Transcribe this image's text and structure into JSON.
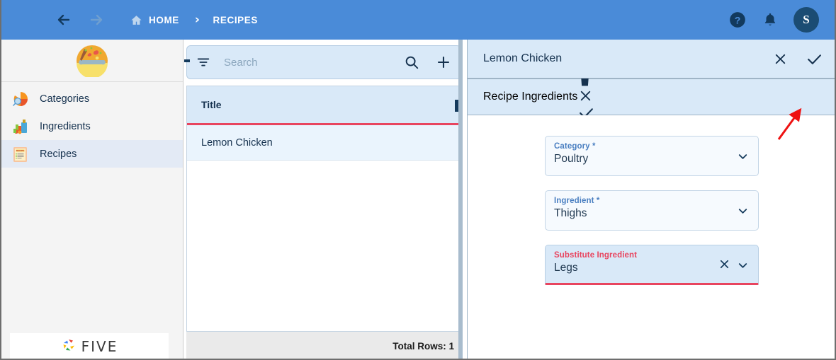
{
  "appbar": {
    "menu_icon": "hamburger-menu-icon",
    "back_icon": "arrow-left-icon",
    "forward_icon": "arrow-right-icon",
    "home_icon": "home-icon",
    "home_label": "HOME",
    "separator": "›",
    "current_label": "RECIPES",
    "help_icon": "help-circle-icon",
    "notifications_icon": "bell-icon",
    "avatar_initial": "S",
    "background_color": "#4a8bd8"
  },
  "sidebar": {
    "logo_icon": "salad-bowl-emoji",
    "logo_glyph": "🥗",
    "items": [
      {
        "label": "Categories",
        "icon": "categories-icon",
        "active": false
      },
      {
        "label": "Ingredients",
        "icon": "ingredients-icon",
        "active": false
      },
      {
        "label": "Recipes",
        "icon": "recipes-icon",
        "active": true
      }
    ],
    "footer": {
      "brand_icon": "five-logo-icon",
      "brand_label": "FIVE"
    },
    "active_background": "#e3eaf5"
  },
  "list_panel": {
    "search": {
      "filter_icon": "filter-icon",
      "placeholder": "Search",
      "value": "",
      "search_icon": "search-icon",
      "add_icon": "plus-icon"
    },
    "grid": {
      "columns": [
        "Title"
      ],
      "rows": [
        {
          "title": "Lemon Chicken"
        }
      ],
      "header_accent_color": "#e8455f",
      "selected_row_color": "#eaf4fd"
    },
    "footer": {
      "total_rows_label": "Total Rows: 1"
    }
  },
  "detail_panel": {
    "record_bar": {
      "title": "Lemon Chicken",
      "cancel_icon": "close-x-icon",
      "confirm_icon": "check-icon"
    },
    "section_bar": {
      "title": "Recipe Ingredients",
      "delete_icon": "trash-icon",
      "cancel_icon": "close-x-icon",
      "confirm_icon": "check-icon"
    },
    "fields": [
      {
        "label": "Category *",
        "value": "Poultry",
        "dropdown_icon": "chevron-down-icon",
        "focused": false,
        "clearable": false
      },
      {
        "label": "Ingredient *",
        "value": "Thighs",
        "dropdown_icon": "chevron-down-icon",
        "focused": false,
        "clearable": false
      },
      {
        "label": "Substitute Ingredient",
        "value": "Legs",
        "dropdown_icon": "chevron-down-icon",
        "clear_icon": "clear-x-icon",
        "focused": true,
        "clearable": true
      }
    ]
  },
  "annotation": {
    "arrow_icon": "red-arrow-pointing-to-confirm",
    "color": "#ee1111"
  }
}
